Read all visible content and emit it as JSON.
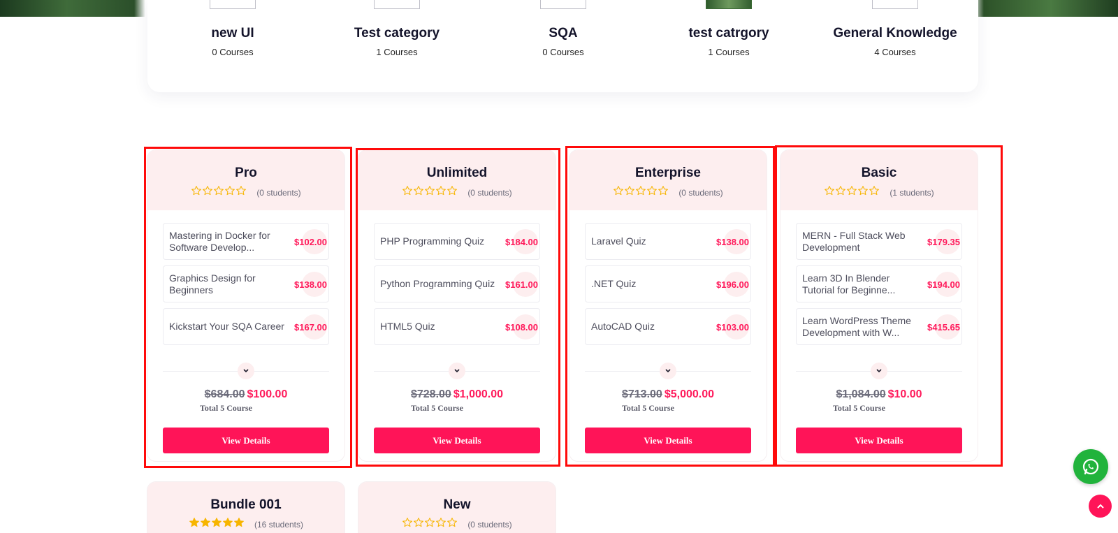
{
  "categories": [
    {
      "name": "new UI",
      "count": "0 Courses",
      "thumb": "blank"
    },
    {
      "name": "Test category",
      "count": "1 Courses",
      "thumb": "blank"
    },
    {
      "name": "SQA",
      "count": "0 Courses",
      "thumb": "blank"
    },
    {
      "name": "test catrgory",
      "count": "1 Courses",
      "thumb": "green"
    },
    {
      "name": "General Knowledge",
      "count": "4 Courses",
      "thumb": "blank"
    }
  ],
  "bundles": [
    {
      "title": "Pro",
      "rating": 0,
      "students": "(0 students)",
      "courses": [
        {
          "name": "Mastering in Docker for Software Develop...",
          "price": "$102.00"
        },
        {
          "name": "Graphics Design for Beginners",
          "price": "$138.00"
        },
        {
          "name": "Kickstart Your SQA Career",
          "price": "$167.00"
        }
      ],
      "old_price": "$684.00",
      "new_price": "$100.00",
      "total": "Total 5 Course",
      "button": "View Details"
    },
    {
      "title": "Unlimited",
      "rating": 0,
      "students": "(0 students)",
      "courses": [
        {
          "name": "PHP Programming Quiz",
          "price": "$184.00"
        },
        {
          "name": "Python Programming Quiz",
          "price": "$161.00"
        },
        {
          "name": "HTML5 Quiz",
          "price": "$108.00"
        }
      ],
      "old_price": "$728.00",
      "new_price": "$1,000.00",
      "total": "Total 5 Course",
      "button": "View Details"
    },
    {
      "title": "Enterprise",
      "rating": 0,
      "students": "(0 students)",
      "courses": [
        {
          "name": "Laravel Quiz",
          "price": "$138.00"
        },
        {
          "name": ".NET Quiz",
          "price": "$196.00"
        },
        {
          "name": "AutoCAD Quiz",
          "price": "$103.00"
        }
      ],
      "old_price": "$713.00",
      "new_price": "$5,000.00",
      "total": "Total 5 Course",
      "button": "View Details"
    },
    {
      "title": "Basic",
      "rating": 0,
      "students": "(1 students)",
      "courses": [
        {
          "name": "MERN - Full Stack Web Development",
          "price": "$179.35"
        },
        {
          "name": "Learn 3D In Blender Tutorial for Beginne...",
          "price": "$194.00"
        },
        {
          "name": "Learn WordPress Theme Development with W...",
          "price": "$415.65"
        }
      ],
      "old_price": "$1,084.00",
      "new_price": "$10.00",
      "total": "Total 5 Course",
      "button": "View Details"
    },
    {
      "title": "Bundle 001",
      "rating": 5,
      "students": "(16 students)"
    },
    {
      "title": "New",
      "rating": 0,
      "students": "(0 students)"
    }
  ],
  "colors": {
    "accent": "#ff1458",
    "card_head": "#fdeeef",
    "star": "#f7b500",
    "highlight": "#ff0a0a",
    "whatsapp": "#21b33c"
  },
  "icons": {
    "whatsapp": "whatsapp-icon",
    "scroll_top": "chevron-up-icon",
    "toggle": "chevron-down-icon",
    "star": "star-icon"
  }
}
